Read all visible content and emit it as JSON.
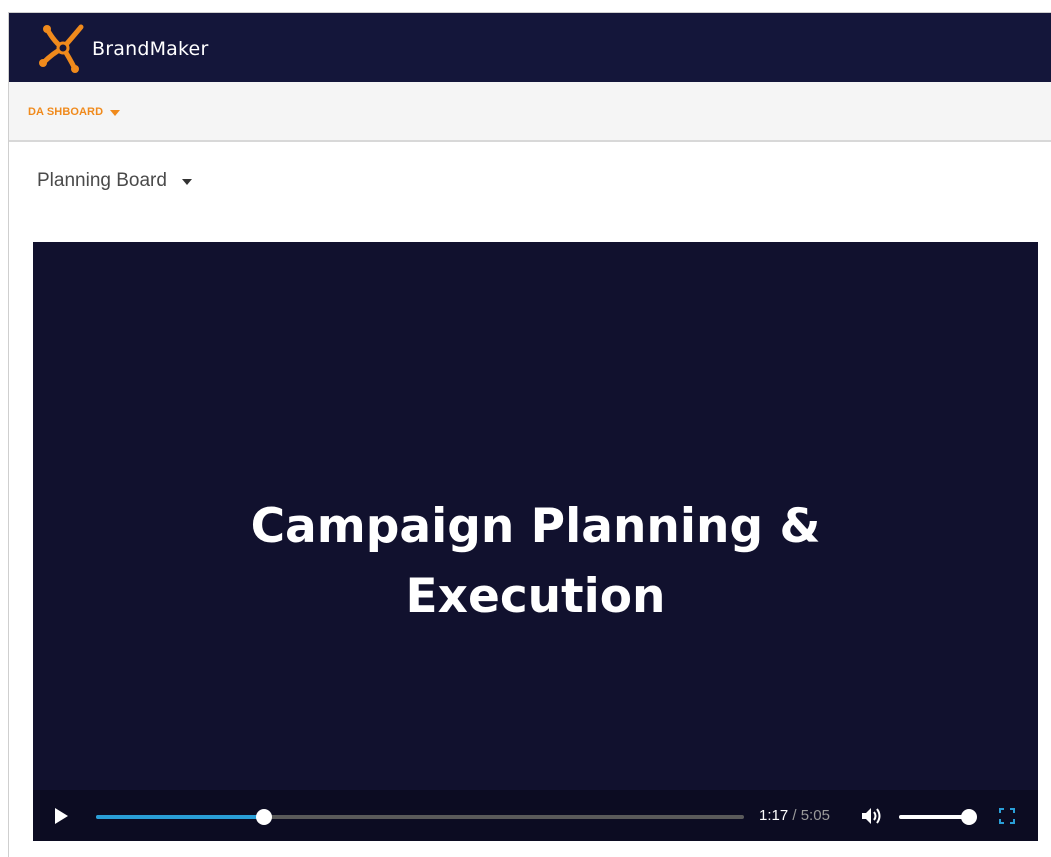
{
  "header": {
    "brand_name": "BrandMaker",
    "logo_icon": "brandmaker-logo-icon",
    "background_color": "#14163a",
    "logo_color": "#f08a1c"
  },
  "nav": {
    "dashboard_label": "DA SHBOARD",
    "dashboard_icon": "caret-down-icon",
    "accent_color": "#f08a1c"
  },
  "view_selector": {
    "selected": "Planning Board",
    "icon": "caret-down-icon"
  },
  "video": {
    "title_line1": "Campaign Planning &",
    "title_line2": "Execution",
    "background_color": "#11112e",
    "player": {
      "current_time": "1:17",
      "separator": "/",
      "duration": "5:05",
      "progress_fraction": 0.26,
      "volume_fraction": 1.0,
      "progress_color": "#2a9fd8",
      "icons": {
        "play": "play-icon",
        "volume": "volume-icon",
        "fullscreen": "fullscreen-icon"
      }
    }
  }
}
